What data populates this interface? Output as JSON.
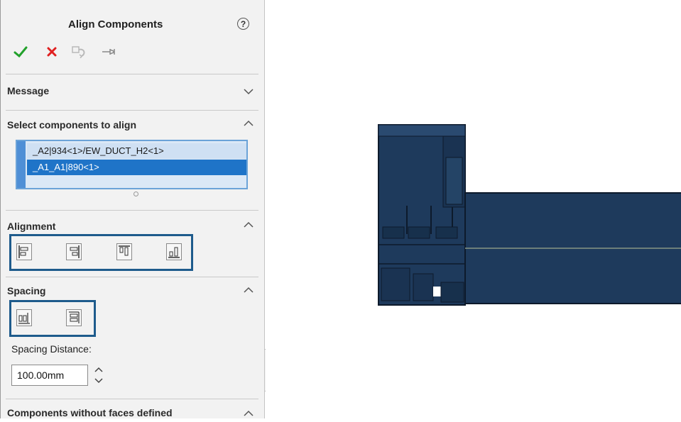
{
  "panel": {
    "title": "Align Components",
    "help_glyph": "?",
    "toolbar": {
      "ok_icon": "checkmark-icon",
      "cancel_icon": "x-icon",
      "undo_icon": "undo-icon",
      "pin_icon": "pushpin-icon"
    },
    "sections": {
      "message": {
        "title": "Message",
        "state": "collapsed"
      },
      "select": {
        "title": "Select components to align",
        "state": "expanded",
        "items": [
          "_A2|934<1>/EW_DUCT_H2<1>",
          "_A1_A1|890<1>"
        ],
        "selected_index": 1
      },
      "alignment": {
        "title": "Alignment",
        "state": "expanded",
        "buttons": [
          "align-left-icon",
          "align-right-icon",
          "align-top-icon",
          "align-bottom-icon"
        ]
      },
      "spacing": {
        "title": "Spacing",
        "state": "expanded",
        "buttons": [
          "space-horizontal-icon",
          "space-vertical-icon"
        ],
        "distance_label": "Spacing Distance:",
        "distance_value": "100.00mm"
      },
      "faces": {
        "title": "Components without faces defined",
        "state": "expanded"
      }
    }
  },
  "viewport": {
    "model_color": "#1e3a5c",
    "model_edge_color": "#0d1a2b"
  },
  "colors": {
    "accept": "#22a12b",
    "cancel": "#e02020",
    "selection": "#1f74c8",
    "group_highlight": "#1e5b8c"
  }
}
